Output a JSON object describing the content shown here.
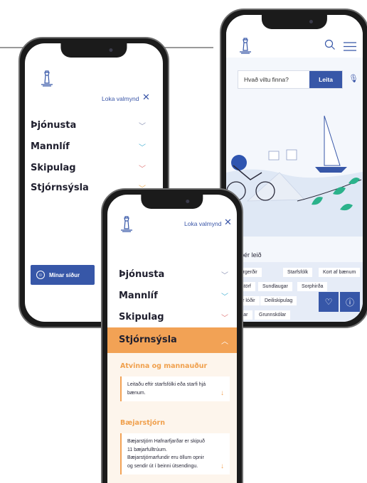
{
  "menu": {
    "close_label": "Loka valmynd",
    "items": [
      {
        "label": "Þjónusta",
        "chevron_color": "#8a93b5"
      },
      {
        "label": "Mannlíf",
        "chevron_color": "#4db3d4"
      },
      {
        "label": "Skipulag",
        "chevron_color": "#e07a7a"
      },
      {
        "label": "Stjórnsýsla",
        "chevron_color": "#f0b35a"
      }
    ],
    "my_pages_button": "Mínar síður"
  },
  "home": {
    "search_placeholder": "Hvað viltu finna?",
    "search_button": "Leita",
    "quick_links_title": "...ttu þér leið",
    "quick_links": [
      "...ndargerðir",
      "Starfsfólk",
      "Kort af bænum",
      "...us störf",
      "Sundlaugar",
      "Sorphirða",
      "...usar lóðir",
      "Deiliskipulag",
      "...skólar",
      "Grunnskólar"
    ]
  },
  "expanded": {
    "active_item": "Stjórnsýsla",
    "sections": [
      {
        "title": "Atvinna og mannauður",
        "text_lines": [
          "Leitaðu eftir starfsfólki eða starfi hjá",
          "bænum."
        ]
      },
      {
        "title": "Bæjarstjórn",
        "text_lines": [
          "Bæjarstjórn Hafnarfjarðar er skipuð",
          "11 bæjarfulltrúum.",
          "Bæjarstjórnarfundir eru öllum opnir",
          "og sendir út í beinni útsendingu."
        ]
      }
    ]
  },
  "colors": {
    "accent_blue": "#3757a8",
    "accent_orange": "#f2a255",
    "text_dark": "#1f1f2e"
  }
}
